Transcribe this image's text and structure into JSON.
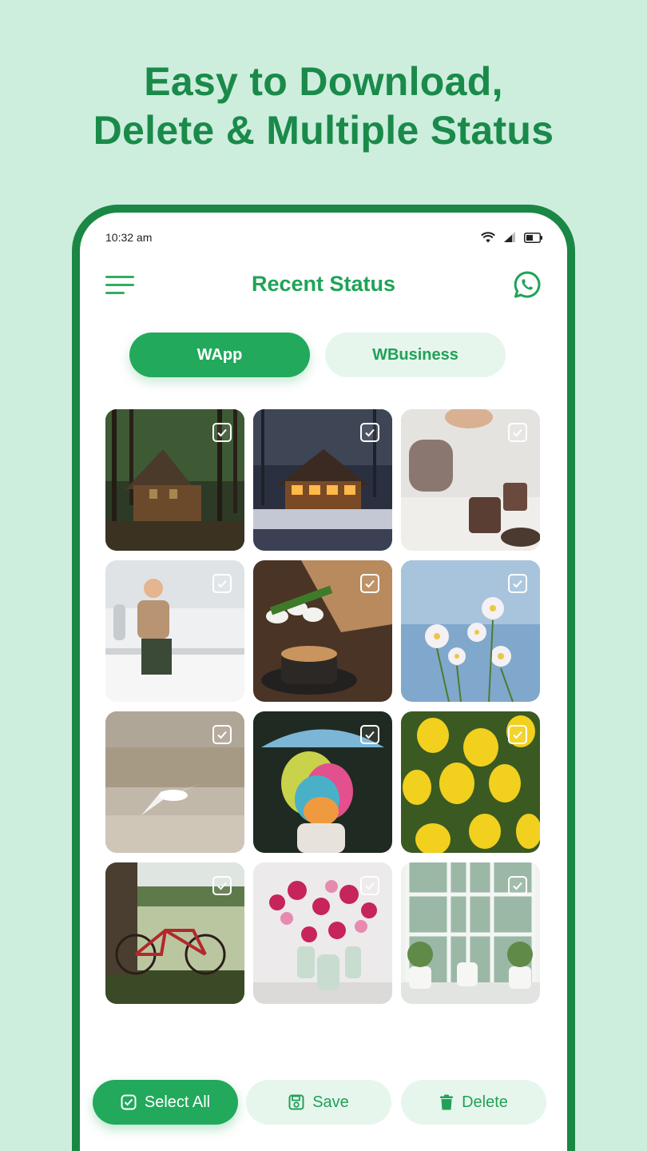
{
  "headline": {
    "line1": "Easy to Download,",
    "line2": "Delete & Multiple Status"
  },
  "statusbar": {
    "time": "10:32 am",
    "icons": [
      "wifi-icon",
      "signal-icon",
      "battery-icon"
    ]
  },
  "appbar": {
    "title": "Recent Status",
    "menu_icon": "hamburger-menu-icon",
    "action_icon": "whatsapp-icon"
  },
  "tabs": [
    {
      "label": "WApp",
      "active": true
    },
    {
      "label": "WBusiness",
      "active": false
    }
  ],
  "grid": {
    "columns": 3,
    "items": [
      {
        "name": "cabin-in-forest",
        "checked": false
      },
      {
        "name": "lit-cabin-snow-night",
        "checked": false
      },
      {
        "name": "teapot-pouring",
        "checked": false
      },
      {
        "name": "boy-on-counter",
        "checked": false
      },
      {
        "name": "coffee-and-tulips",
        "checked": false
      },
      {
        "name": "cosmos-flowers-sky",
        "checked": false
      },
      {
        "name": "seagull-beach",
        "checked": false
      },
      {
        "name": "umbrella-color-powder",
        "checked": false
      },
      {
        "name": "yellow-tulips",
        "checked": false
      },
      {
        "name": "bicycle-under-tree",
        "checked": false
      },
      {
        "name": "flowers-in-vases",
        "checked": false
      },
      {
        "name": "window-with-plants",
        "checked": false
      }
    ]
  },
  "actions": {
    "select_all": "Select All",
    "save": "Save",
    "delete": "Delete"
  },
  "colors": {
    "background": "#cdeedd",
    "primary": "#22a95c",
    "heading": "#1a8a4a",
    "soft": "#e6f6ec",
    "frame": "#1b8745"
  }
}
